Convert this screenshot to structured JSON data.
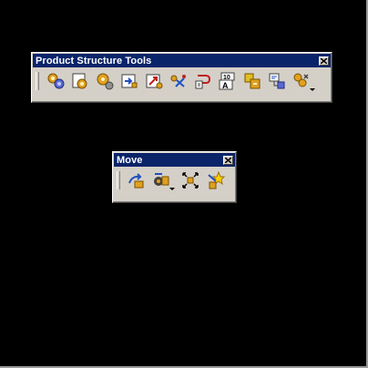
{
  "toolbars": [
    {
      "title": "Product Structure Tools",
      "tools": [
        {
          "icon": "gears-component-icon"
        },
        {
          "icon": "new-product-icon"
        },
        {
          "icon": "new-part-icon"
        },
        {
          "icon": "existing-component-icon"
        },
        {
          "icon": "existing-component-positioning-icon"
        },
        {
          "icon": "replace-component-icon"
        },
        {
          "icon": "graph-tree-reordering-icon"
        },
        {
          "icon": "generate-numbering-icon"
        },
        {
          "icon": "selective-load-icon"
        },
        {
          "icon": "manage-representations-icon"
        },
        {
          "icon": "multi-instantiation-icon",
          "dropdown": true
        }
      ]
    },
    {
      "title": "Move",
      "tools": [
        {
          "icon": "manipulation-icon"
        },
        {
          "icon": "snap-icon",
          "dropdown": true
        },
        {
          "icon": "explode-icon"
        },
        {
          "icon": "stop-manipulate-on-clash-icon"
        }
      ]
    }
  ],
  "colors": {
    "title_bg": "#0a246a",
    "title_text": "#ffffff",
    "toolbar_face": "#d4d0c8",
    "desktop": "#000000"
  }
}
